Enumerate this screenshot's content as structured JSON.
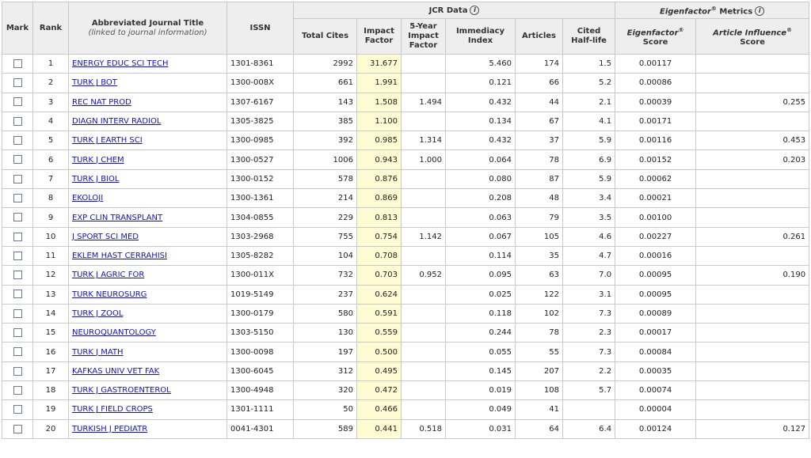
{
  "headers": {
    "mark": "Mark",
    "rank": "Rank",
    "title": "Abbreviated Journal Title",
    "title_sub": "(linked to journal information)",
    "issn": "ISSN",
    "jcr_group": "JCR Data",
    "eigen_group": "Eigenfactor",
    "eigen_group_suffix": "Metrics",
    "total_cites": "Total Cites",
    "impact_factor_1": "Impact",
    "impact_factor_2": "Factor",
    "five_year_1": "5-Year",
    "five_year_2": "Impact",
    "five_year_3": "Factor",
    "immediacy_1": "Immediacy",
    "immediacy_2": "Index",
    "articles": "Articles",
    "cited_1": "Cited",
    "cited_2": "Half-life",
    "eigen_score_1": "Eigenfactor",
    "eigen_score_2": "Score",
    "article_influence_1": "Article Influence",
    "article_influence_2": "Score",
    "info_glyph": "i",
    "registered": "®"
  },
  "rows": [
    {
      "rank": "1",
      "title": "ENERGY EDUC SCI TECH",
      "issn": "1301-8361",
      "total_cites": "2992",
      "impact": "31.677",
      "five_year": "",
      "immediacy": "5.460",
      "articles": "174",
      "half_life": "1.5",
      "eigen": "0.00117",
      "influence": ""
    },
    {
      "rank": "2",
      "title": "TURK J BOT",
      "issn": "1300-008X",
      "total_cites": "661",
      "impact": "1.991",
      "five_year": "",
      "immediacy": "0.121",
      "articles": "66",
      "half_life": "5.2",
      "eigen": "0.00086",
      "influence": ""
    },
    {
      "rank": "3",
      "title": "REC NAT PROD",
      "issn": "1307-6167",
      "total_cites": "143",
      "impact": "1.508",
      "five_year": "1.494",
      "immediacy": "0.432",
      "articles": "44",
      "half_life": "2.1",
      "eigen": "0.00039",
      "influence": "0.255"
    },
    {
      "rank": "4",
      "title": "DIAGN INTERV RADIOL",
      "issn": "1305-3825",
      "total_cites": "385",
      "impact": "1.100",
      "five_year": "",
      "immediacy": "0.134",
      "articles": "67",
      "half_life": "4.1",
      "eigen": "0.00171",
      "influence": ""
    },
    {
      "rank": "5",
      "title": "TURK J EARTH SCI",
      "issn": "1300-0985",
      "total_cites": "392",
      "impact": "0.985",
      "five_year": "1.314",
      "immediacy": "0.432",
      "articles": "37",
      "half_life": "5.9",
      "eigen": "0.00116",
      "influence": "0.453"
    },
    {
      "rank": "6",
      "title": "TURK J CHEM",
      "issn": "1300-0527",
      "total_cites": "1006",
      "impact": "0.943",
      "five_year": "1.000",
      "immediacy": "0.064",
      "articles": "78",
      "half_life": "6.9",
      "eigen": "0.00152",
      "influence": "0.203"
    },
    {
      "rank": "7",
      "title": "TURK J BIOL",
      "issn": "1300-0152",
      "total_cites": "578",
      "impact": "0.876",
      "five_year": "",
      "immediacy": "0.080",
      "articles": "87",
      "half_life": "5.9",
      "eigen": "0.00062",
      "influence": ""
    },
    {
      "rank": "8",
      "title": "EKOLOJI",
      "issn": "1300-1361",
      "total_cites": "214",
      "impact": "0.869",
      "five_year": "",
      "immediacy": "0.208",
      "articles": "48",
      "half_life": "3.4",
      "eigen": "0.00021",
      "influence": ""
    },
    {
      "rank": "9",
      "title": "EXP CLIN TRANSPLANT",
      "issn": "1304-0855",
      "total_cites": "229",
      "impact": "0.813",
      "five_year": "",
      "immediacy": "0.063",
      "articles": "79",
      "half_life": "3.5",
      "eigen": "0.00100",
      "influence": ""
    },
    {
      "rank": "10",
      "title": "J SPORT SCI MED",
      "issn": "1303-2968",
      "total_cites": "755",
      "impact": "0.754",
      "five_year": "1.142",
      "immediacy": "0.067",
      "articles": "105",
      "half_life": "4.6",
      "eigen": "0.00227",
      "influence": "0.261"
    },
    {
      "rank": "11",
      "title": "EKLEM HAST CERRAHISI",
      "issn": "1305-8282",
      "total_cites": "104",
      "impact": "0.708",
      "five_year": "",
      "immediacy": "0.114",
      "articles": "35",
      "half_life": "4.7",
      "eigen": "0.00016",
      "influence": ""
    },
    {
      "rank": "12",
      "title": "TURK J AGRIC FOR",
      "issn": "1300-011X",
      "total_cites": "732",
      "impact": "0.703",
      "five_year": "0.952",
      "immediacy": "0.095",
      "articles": "63",
      "half_life": "7.0",
      "eigen": "0.00095",
      "influence": "0.190"
    },
    {
      "rank": "13",
      "title": "TURK NEUROSURG",
      "issn": "1019-5149",
      "total_cites": "237",
      "impact": "0.624",
      "five_year": "",
      "immediacy": "0.025",
      "articles": "122",
      "half_life": "3.1",
      "eigen": "0.00095",
      "influence": ""
    },
    {
      "rank": "14",
      "title": "TURK J ZOOL",
      "issn": "1300-0179",
      "total_cites": "580",
      "impact": "0.591",
      "five_year": "",
      "immediacy": "0.118",
      "articles": "102",
      "half_life": "7.3",
      "eigen": "0.00089",
      "influence": ""
    },
    {
      "rank": "15",
      "title": "NEUROQUANTOLOGY",
      "issn": "1303-5150",
      "total_cites": "130",
      "impact": "0.559",
      "five_year": "",
      "immediacy": "0.244",
      "articles": "78",
      "half_life": "2.3",
      "eigen": "0.00017",
      "influence": ""
    },
    {
      "rank": "16",
      "title": "TURK J MATH",
      "issn": "1300-0098",
      "total_cites": "197",
      "impact": "0.500",
      "five_year": "",
      "immediacy": "0.055",
      "articles": "55",
      "half_life": "7.3",
      "eigen": "0.00084",
      "influence": ""
    },
    {
      "rank": "17",
      "title": "KAFKAS UNIV VET FAK",
      "issn": "1300-6045",
      "total_cites": "312",
      "impact": "0.495",
      "five_year": "",
      "immediacy": "0.145",
      "articles": "207",
      "half_life": "2.2",
      "eigen": "0.00035",
      "influence": ""
    },
    {
      "rank": "18",
      "title": "TURK J GASTROENTEROL",
      "issn": "1300-4948",
      "total_cites": "320",
      "impact": "0.472",
      "five_year": "",
      "immediacy": "0.019",
      "articles": "108",
      "half_life": "5.7",
      "eigen": "0.00074",
      "influence": ""
    },
    {
      "rank": "19",
      "title": "TURK J FIELD CROPS",
      "issn": "1301-1111",
      "total_cites": "50",
      "impact": "0.466",
      "five_year": "",
      "immediacy": "0.049",
      "articles": "41",
      "half_life": "",
      "eigen": "0.00004",
      "influence": ""
    },
    {
      "rank": "20",
      "title": "TURKISH J PEDIATR",
      "issn": "0041-4301",
      "total_cites": "589",
      "impact": "0.441",
      "five_year": "0.518",
      "immediacy": "0.031",
      "articles": "64",
      "half_life": "6.4",
      "eigen": "0.00124",
      "influence": "0.127"
    }
  ],
  "colors": {
    "header_bg": "#eeeeee",
    "impact_highlight": "#fffbd2",
    "link": "#1111cc",
    "grid": "#c9c9c9"
  }
}
